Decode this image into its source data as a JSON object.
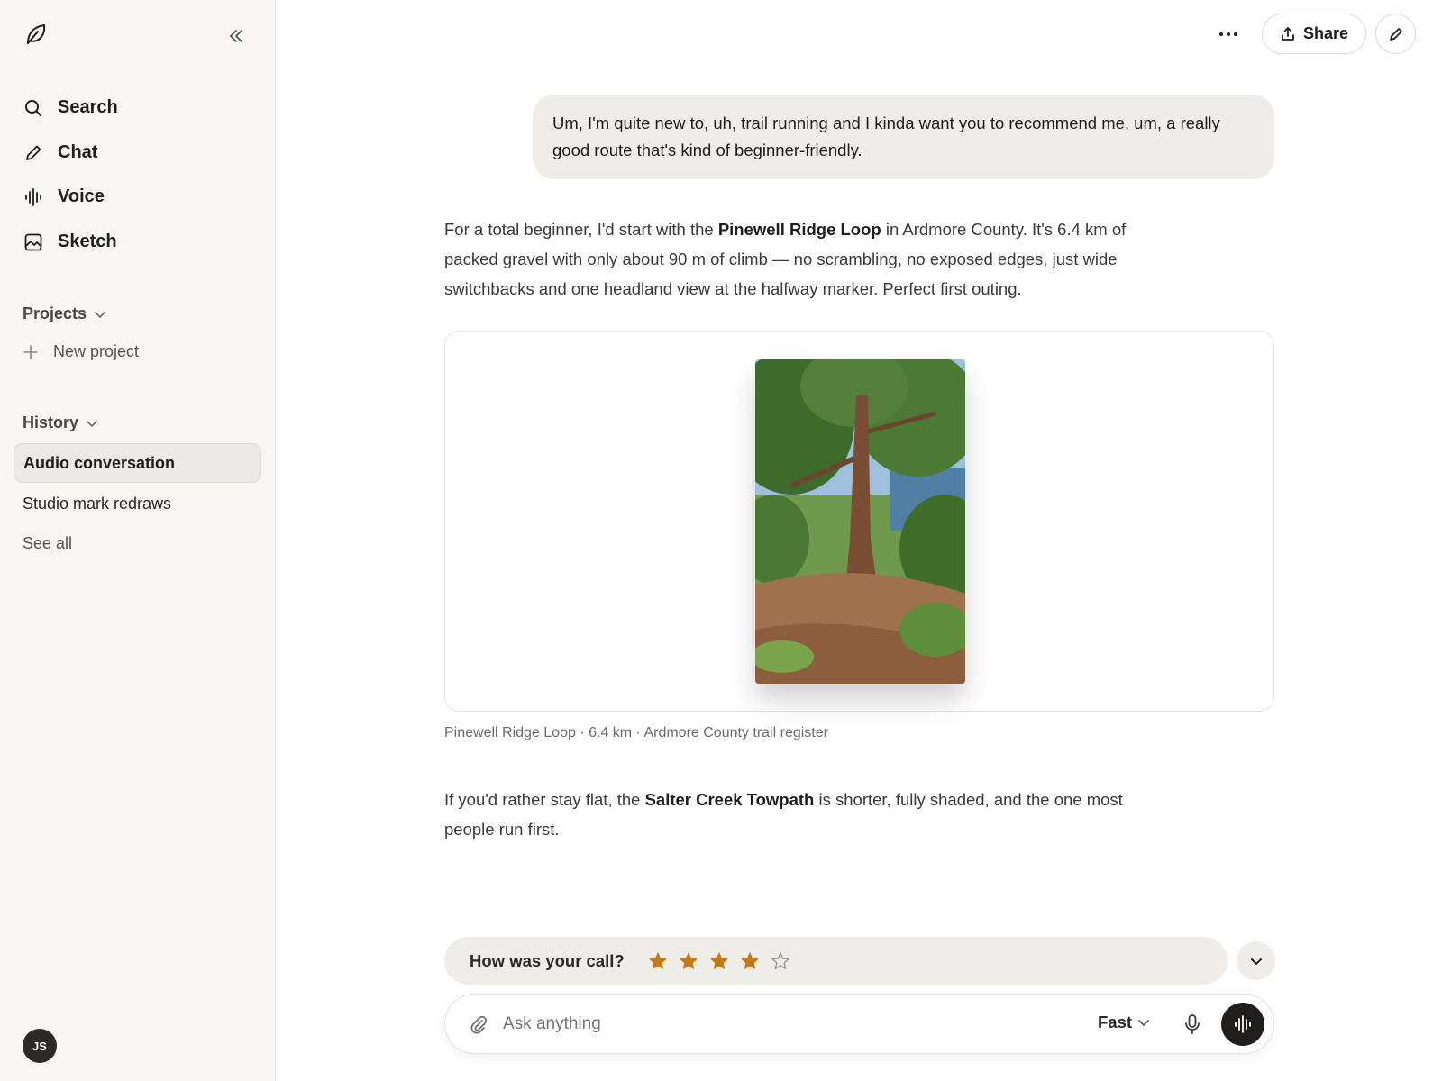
{
  "sidebar": {
    "nav": [
      {
        "label": "Search",
        "icon": "search-icon"
      },
      {
        "label": "Chat",
        "icon": "pencil-icon"
      },
      {
        "label": "Voice",
        "icon": "waveform-icon"
      },
      {
        "label": "Sketch",
        "icon": "image-icon"
      }
    ],
    "projects_title": "Projects",
    "new_project_label": "New project",
    "history_title": "History",
    "history": [
      {
        "label": "Audio conversation",
        "active": true
      },
      {
        "label": "Studio mark redraws",
        "active": false
      }
    ],
    "see_all_label": "See all",
    "avatar_initials": "JS"
  },
  "topbar": {
    "share_label": "Share"
  },
  "conversation": {
    "user_message": "Um, I'm quite new to, uh, trail running and I kinda want you to recommend me, um, a really good route that's kind of beginner-friendly.",
    "answer_1": {
      "pre": "For a total beginner, I'd start with the ",
      "bold": "Pinewell Ridge Loop",
      "post": " in Ardmore County. It's 6.4 km of packed gravel with only about 90 m of climb — no scrambling, no exposed edges, just wide switchbacks and one headland view at the halfway marker. Perfect first outing."
    },
    "image_caption": "Pinewell Ridge Loop · 6.4 km · Ardmore County trail register",
    "answer_2": {
      "pre": "If you'd rather stay flat, the ",
      "bold": "Salter Creek Towpath",
      "post": " is shorter, fully shaded, and the one most people run first."
    }
  },
  "feedback": {
    "label": "How was your call?",
    "rating": 4,
    "max_rating": 5,
    "star_color": "#c47a1a"
  },
  "composer": {
    "placeholder": "Ask anything",
    "mode_label": "Fast"
  }
}
